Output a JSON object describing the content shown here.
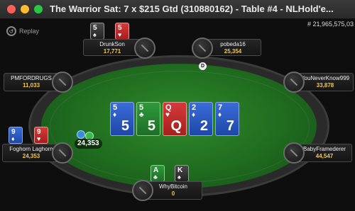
{
  "window": {
    "title": "The Warrior Sat: 7 x $215 Gtd  (310880162) - Table #4 - NLHold'e..."
  },
  "toolbar": {
    "replay_label": "Replay"
  },
  "hand_id": "# 21,965,575,03",
  "dealer_button_label": "D",
  "pot": "24,353",
  "board": [
    {
      "rank": "5",
      "suit": "♦",
      "color": "diamond"
    },
    {
      "rank": "5",
      "suit": "♣",
      "color": "club"
    },
    {
      "rank": "Q",
      "suit": "♥",
      "color": "heart"
    },
    {
      "rank": "2",
      "suit": "♦",
      "color": "diamond"
    },
    {
      "rank": "7",
      "suit": "♦",
      "color": "diamond"
    }
  ],
  "players": {
    "drunkson": {
      "name": "DrunkSon",
      "stack": "17,771",
      "cards": [
        {
          "rank": "5",
          "suit": "♠",
          "color": "spade"
        },
        {
          "rank": "5",
          "suit": "♥",
          "color": "heart"
        }
      ]
    },
    "pobeda16": {
      "name": "pobeda16",
      "stack": "25,354"
    },
    "pmfordrugs": {
      "name": "PMFORDRUGS",
      "stack": "11,033"
    },
    "youneverknow": {
      "name": "YouNeverKnow999",
      "stack": "33,878"
    },
    "foghorn": {
      "name": "Foghorn Laghorn",
      "stack": "24,353",
      "cards": [
        {
          "rank": "9",
          "suit": "♦",
          "color": "diamond"
        },
        {
          "rank": "9",
          "suit": "♥",
          "color": "heart"
        }
      ]
    },
    "babyframederer": {
      "name": "BabyFramederer",
      "stack": "44,547"
    },
    "whybitcoin": {
      "name": "WhyBitcoin",
      "stack": "0",
      "cards": [
        {
          "rank": "A",
          "suit": "♣",
          "color": "club"
        },
        {
          "rank": "K",
          "suit": "♠",
          "color": "spade"
        }
      ]
    }
  },
  "colors": {
    "felt": "#1f6b1f",
    "stack_text": "#f5c842",
    "diamond": "#2a58c0",
    "heart": "#c02a2a",
    "club": "#2a8a35",
    "spade": "#333333"
  }
}
